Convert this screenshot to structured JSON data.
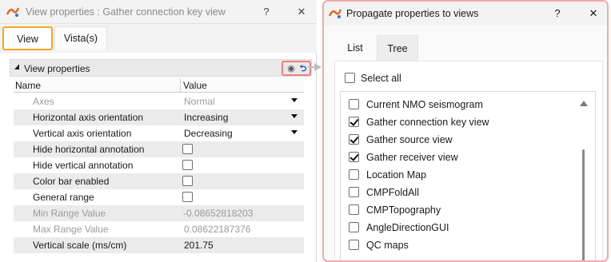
{
  "left_window": {
    "title": "View properties : Gather connection key view",
    "help": "?",
    "close": "✕",
    "tabs": [
      {
        "label": "View",
        "active": true
      },
      {
        "label": "Vista(s)",
        "active": false
      }
    ],
    "section_title": "View properties",
    "columns": {
      "name": "Name",
      "value": "Value"
    },
    "properties": [
      {
        "name": "Axes",
        "value": "Normal",
        "type": "dropdown",
        "disabled": true
      },
      {
        "name": "Horizontal axis orientation",
        "value": "Increasing",
        "type": "dropdown",
        "disabled": false
      },
      {
        "name": "Vertical axis orientation",
        "value": "Decreasing",
        "type": "dropdown",
        "disabled": false
      },
      {
        "name": "Hide horizontal annotation",
        "value": "",
        "type": "checkbox",
        "checked": false,
        "disabled": false
      },
      {
        "name": "Hide vertical annotation",
        "value": "",
        "type": "checkbox",
        "checked": false,
        "disabled": false
      },
      {
        "name": "Color bar enabled",
        "value": "",
        "type": "checkbox",
        "checked": false,
        "disabled": false
      },
      {
        "name": "General range",
        "value": "",
        "type": "checkbox",
        "checked": false,
        "disabled": false
      },
      {
        "name": "Min Range Value",
        "value": "-0.08652818203",
        "type": "text",
        "disabled": true
      },
      {
        "name": "Max Range Value",
        "value": "0.08622187376",
        "type": "text",
        "disabled": true
      },
      {
        "name": "Vertical scale (ms/cm)",
        "value": "201.75",
        "type": "text",
        "disabled": false
      }
    ]
  },
  "right_window": {
    "title": "Propagate properties to views",
    "help": "?",
    "close": "✕",
    "tabs": [
      {
        "label": "List",
        "active": true
      },
      {
        "label": "Tree",
        "active": false
      }
    ],
    "select_all_label": "Select all",
    "views": [
      {
        "label": "Current NMO seismogram",
        "checked": false
      },
      {
        "label": "Gather connection key view",
        "checked": true
      },
      {
        "label": "Gather source view",
        "checked": true
      },
      {
        "label": "Gather receiver view",
        "checked": true
      },
      {
        "label": "Location Map",
        "checked": false
      },
      {
        "label": "CMPFoldAll",
        "checked": false
      },
      {
        "label": "CMPTopography",
        "checked": false
      },
      {
        "label": "AngleDirectionGUI",
        "checked": false
      },
      {
        "label": "QC maps",
        "checked": false
      }
    ]
  },
  "colors": {
    "active_tab_border": "#f5a623",
    "highlight_border": "#f08080",
    "undo_icon": "#1a4db3"
  },
  "icons": {
    "app": "app-logo-icon",
    "propagate": "propagate-icon",
    "undo": "undo-icon"
  }
}
